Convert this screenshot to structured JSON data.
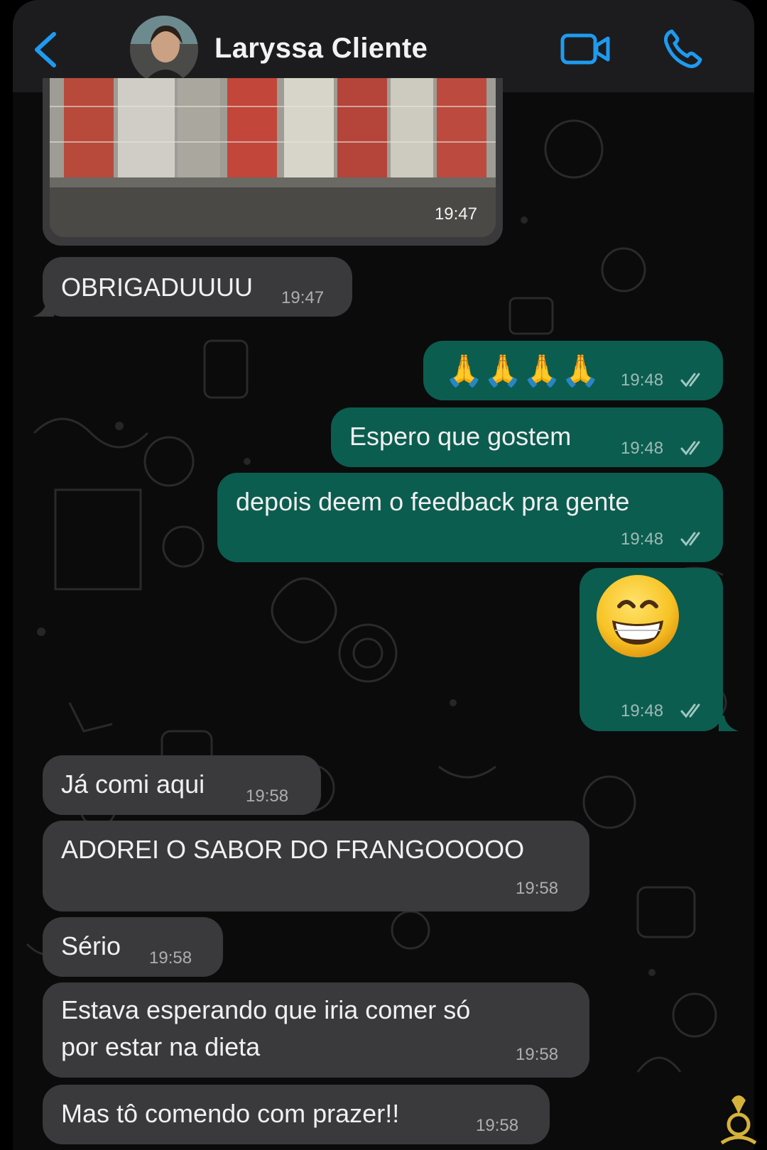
{
  "header": {
    "contact_name": "Laryssa Cliente",
    "back_icon": "chevron-left-icon",
    "video_icon": "video-camera-icon",
    "call_icon": "phone-icon",
    "accent_color": "#1e9bf0"
  },
  "messages": [
    {
      "type": "image",
      "direction": "incoming",
      "time": "19:47"
    },
    {
      "type": "text",
      "direction": "incoming",
      "text": "OBRIGADUUUU",
      "time": "19:47"
    },
    {
      "type": "emoji",
      "direction": "outgoing",
      "text": "🙏🙏🙏🙏",
      "time": "19:48",
      "read": true
    },
    {
      "type": "text",
      "direction": "outgoing",
      "text": "Espero que gostem",
      "time": "19:48",
      "read": true
    },
    {
      "type": "text",
      "direction": "outgoing",
      "text": "depois deem o feedback pra gente",
      "time": "19:48",
      "read": true
    },
    {
      "type": "emoji",
      "direction": "outgoing",
      "text": "😁",
      "time": "19:48",
      "read": true
    },
    {
      "type": "text",
      "direction": "incoming",
      "text": "Já comi aqui",
      "time": "19:58"
    },
    {
      "type": "text",
      "direction": "incoming",
      "text": "ADOREI O SABOR DO FRANGOOOOO",
      "time": "19:58"
    },
    {
      "type": "text",
      "direction": "incoming",
      "text": "Sério",
      "time": "19:58"
    },
    {
      "type": "text",
      "direction": "incoming",
      "text_line1": "Estava esperando que iria comer só",
      "text_line2": "por estar na dieta",
      "time": "19:58"
    },
    {
      "type": "text",
      "direction": "incoming",
      "text": "Mas tô comendo com prazer!!",
      "time": "19:58"
    }
  ],
  "colors": {
    "incoming_bubble": "#3a3a3c",
    "outgoing_bubble": "#0b5d4f",
    "header_bg": "#1c1c1e",
    "wallpaper": "#0b0b0b"
  }
}
